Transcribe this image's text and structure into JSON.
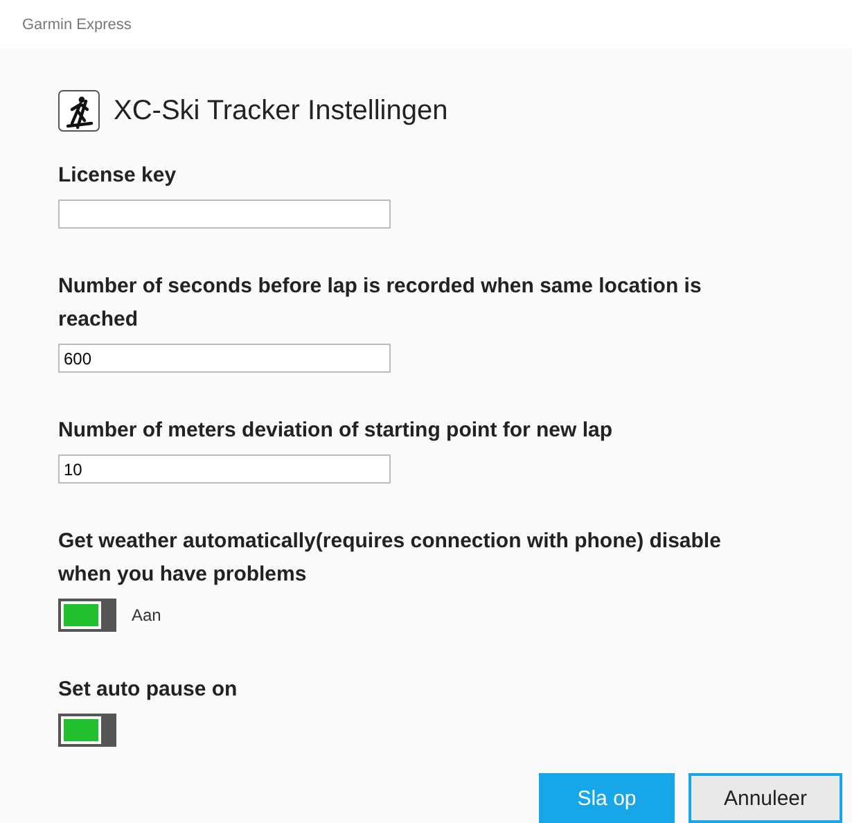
{
  "window": {
    "title": "Garmin Express"
  },
  "page": {
    "title": "XC-Ski Tracker Instellingen"
  },
  "settings": [
    {
      "kind": "text",
      "label": "License key"
    },
    {
      "kind": "text",
      "label": "Number of seconds before lap is recorded when same location is reached",
      "value": "600"
    },
    {
      "kind": "text",
      "label": "Number of meters deviation of starting point for new lap",
      "value": "10"
    },
    {
      "kind": "toggle",
      "label": "Get weather automatically(requires connection with phone) disable when you have problems",
      "on": true,
      "state_label": "Aan"
    },
    {
      "kind": "toggle",
      "label": "Set auto pause on",
      "on": true
    }
  ],
  "buttons": [
    {
      "label": "Sla op",
      "kind": "primary"
    },
    {
      "label": "Annuleer",
      "kind": "secondary"
    }
  ]
}
